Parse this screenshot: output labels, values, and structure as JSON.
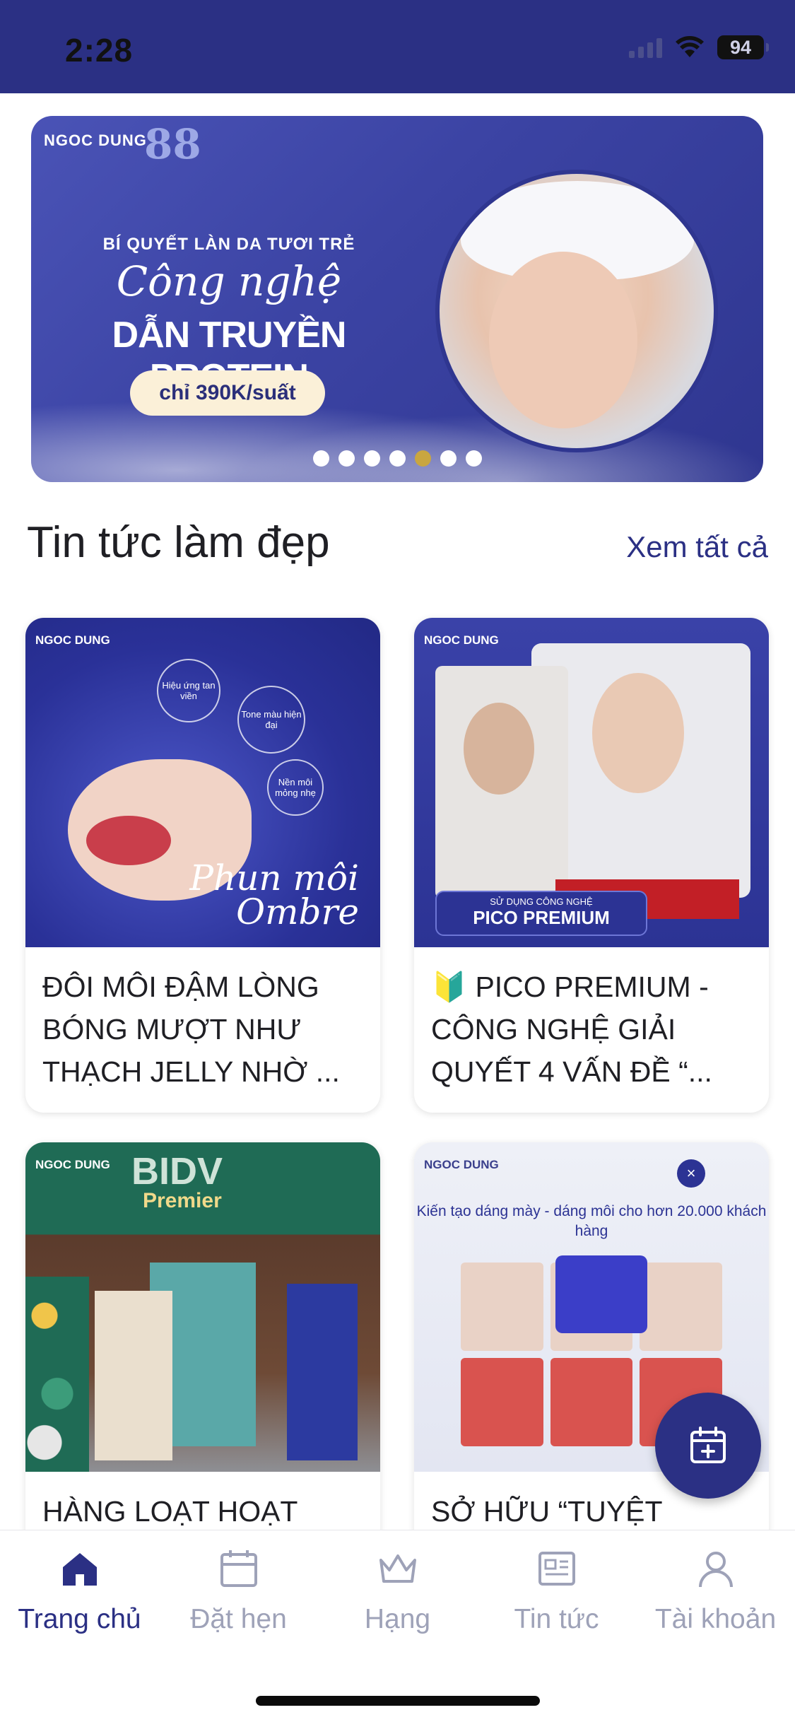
{
  "status_bar": {
    "time": "2:28",
    "battery": "94"
  },
  "banner": {
    "brand": "NGOC DUNG",
    "badge": "88",
    "line1": "BÍ QUYẾT LÀN DA TƯƠI TRẺ",
    "line2": "Công nghệ",
    "line3": "DẪN TRUYỀN PROTEIN",
    "price": "chỉ 390K/suất",
    "dot_count": 7,
    "active_dot": 5
  },
  "news_section": {
    "title": "Tin tức làm đẹp",
    "see_all": "Xem tất cả",
    "cards": [
      {
        "title": "ĐÔI MÔI ĐẬM LÒNG BÓNG MƯỢT NHƯ THẠCH JELLY NHỜ ...",
        "image": {
          "brand": "NGOC DUNG",
          "bubble1": "Hiệu ứng tan viền",
          "bubble2": "Tone màu hiện đại",
          "bubble3": "Nền môi mỏng nhẹ",
          "script_line1": "Phun môi",
          "script_line2": "Ombre"
        }
      },
      {
        "title": "🔰 PICO PREMIUM - CÔNG NGHỆ GIẢI QUYẾT 4 VẤN ĐỀ “...",
        "image": {
          "brand": "NGOC DUNG",
          "tag_small": "SỬ DỤNG CÔNG NGHỆ",
          "tag_big": "PICO PREMIUM"
        }
      },
      {
        "title": "HÀNG LOẠT HOẠT",
        "image": {
          "brand": "NGOC DUNG",
          "sign": "BIDV",
          "sign_sub": "Premier"
        }
      },
      {
        "title": "SỞ HỮU “TUYỆT",
        "image": {
          "brand": "NGOC DUNG",
          "headline": "Kiến tạo dáng mày - dáng môi cho hơn 20.000 khách hàng",
          "close": "×"
        }
      }
    ]
  },
  "fab": {
    "icon": "calendar-add-icon"
  },
  "tabbar": {
    "active_index": 0,
    "items": [
      {
        "label": "Trang chủ",
        "icon": "home-icon"
      },
      {
        "label": "Đặt hẹn",
        "icon": "calendar-icon"
      },
      {
        "label": "Hạng",
        "icon": "crown-icon"
      },
      {
        "label": "Tin tức",
        "icon": "news-icon"
      },
      {
        "label": "Tài khoản",
        "icon": "user-icon"
      }
    ]
  },
  "colors": {
    "primary": "#2b3084",
    "inactive": "#9ea2b8",
    "dot_active": "#c9a640"
  }
}
